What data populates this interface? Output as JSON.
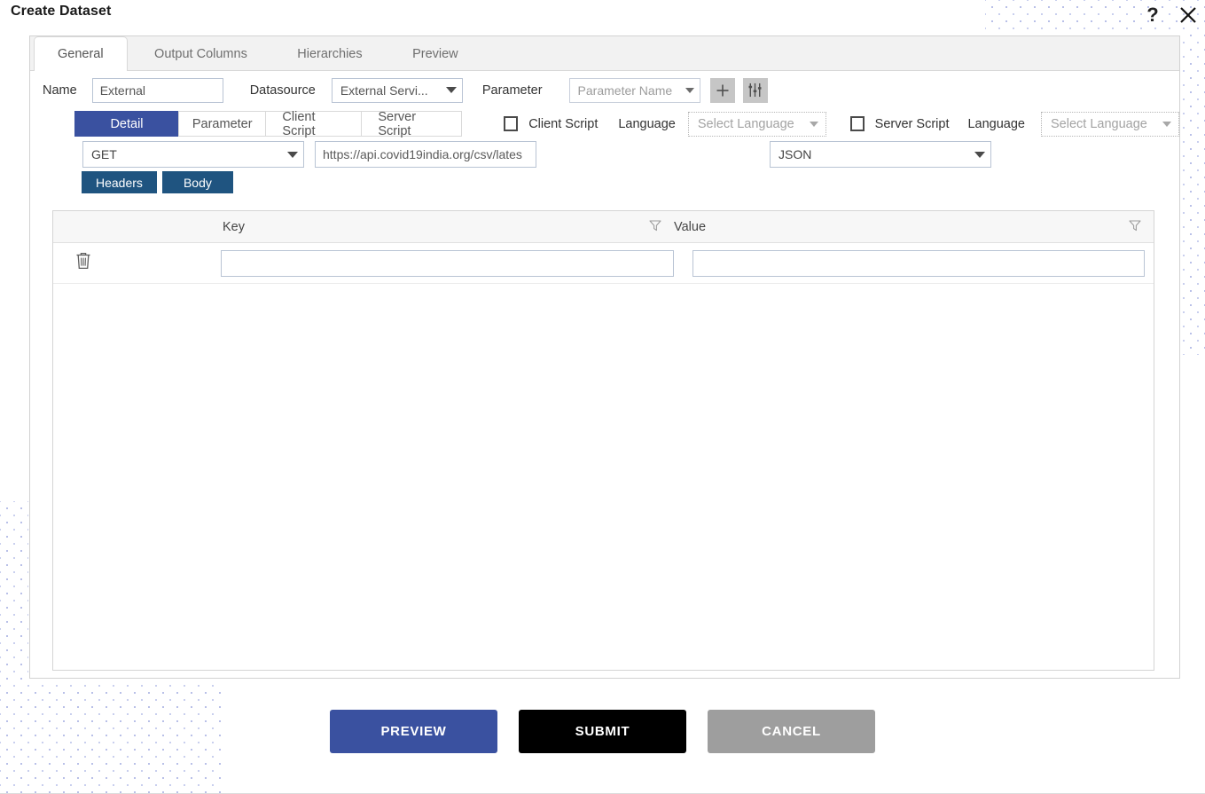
{
  "window": {
    "title": "Create Dataset",
    "help_icon": "question-mark-icon",
    "close_icon": "close-icon"
  },
  "top_tabs": [
    {
      "label": "General",
      "active": true
    },
    {
      "label": "Output Columns",
      "active": false
    },
    {
      "label": "Hierarchies",
      "active": false
    },
    {
      "label": "Preview",
      "active": false
    }
  ],
  "meta": {
    "name_label": "Name",
    "name_value": "External",
    "name_placeholder": "",
    "datasource_label": "Datasource",
    "datasource_value": "External Servi...",
    "parameter_label": "Parameter",
    "parameter_value": "Parameter Name",
    "add_button_icon": "plus-icon",
    "settings_button_icon": "sliders-icon"
  },
  "sub_tabs": [
    {
      "label": "Detail",
      "active": true
    },
    {
      "label": "Parameter",
      "active": false
    },
    {
      "label": "Client Script",
      "active": false
    },
    {
      "label": "Server Script",
      "active": false
    }
  ],
  "scripts": {
    "client": {
      "checkbox_checked": false,
      "label": "Client Script",
      "language_label": "Language",
      "language_value": "Select Language"
    },
    "server": {
      "checkbox_checked": false,
      "label": "Server Script",
      "language_label": "Language",
      "language_value": "Select Language"
    }
  },
  "request": {
    "method": "GET",
    "url": "https://api.covid19india.org/csv/lates",
    "url_placeholder": "Enter URL",
    "format": "JSON"
  },
  "payload_tabs": [
    {
      "label": "Headers",
      "active": true
    },
    {
      "label": "Body",
      "active": false
    }
  ],
  "grid": {
    "columns": [
      "",
      "Key",
      "Value"
    ],
    "key_header": "Key",
    "value_header": "Value",
    "filter_icon": "filter-icon",
    "delete_icon": "trash-icon",
    "rows": [
      {
        "key": "",
        "value": "",
        "key_placeholder": "",
        "value_placeholder": ""
      }
    ]
  },
  "footer": {
    "preview_label": "PREVIEW",
    "submit_label": "SUBMIT",
    "cancel_label": "CANCEL"
  },
  "colors": {
    "accent_blue": "#3a51a0",
    "tab_navy": "#1f5480",
    "submit_black": "#000000",
    "cancel_grey": "#9e9e9e",
    "dot_pattern": "#b9c0e8"
  }
}
